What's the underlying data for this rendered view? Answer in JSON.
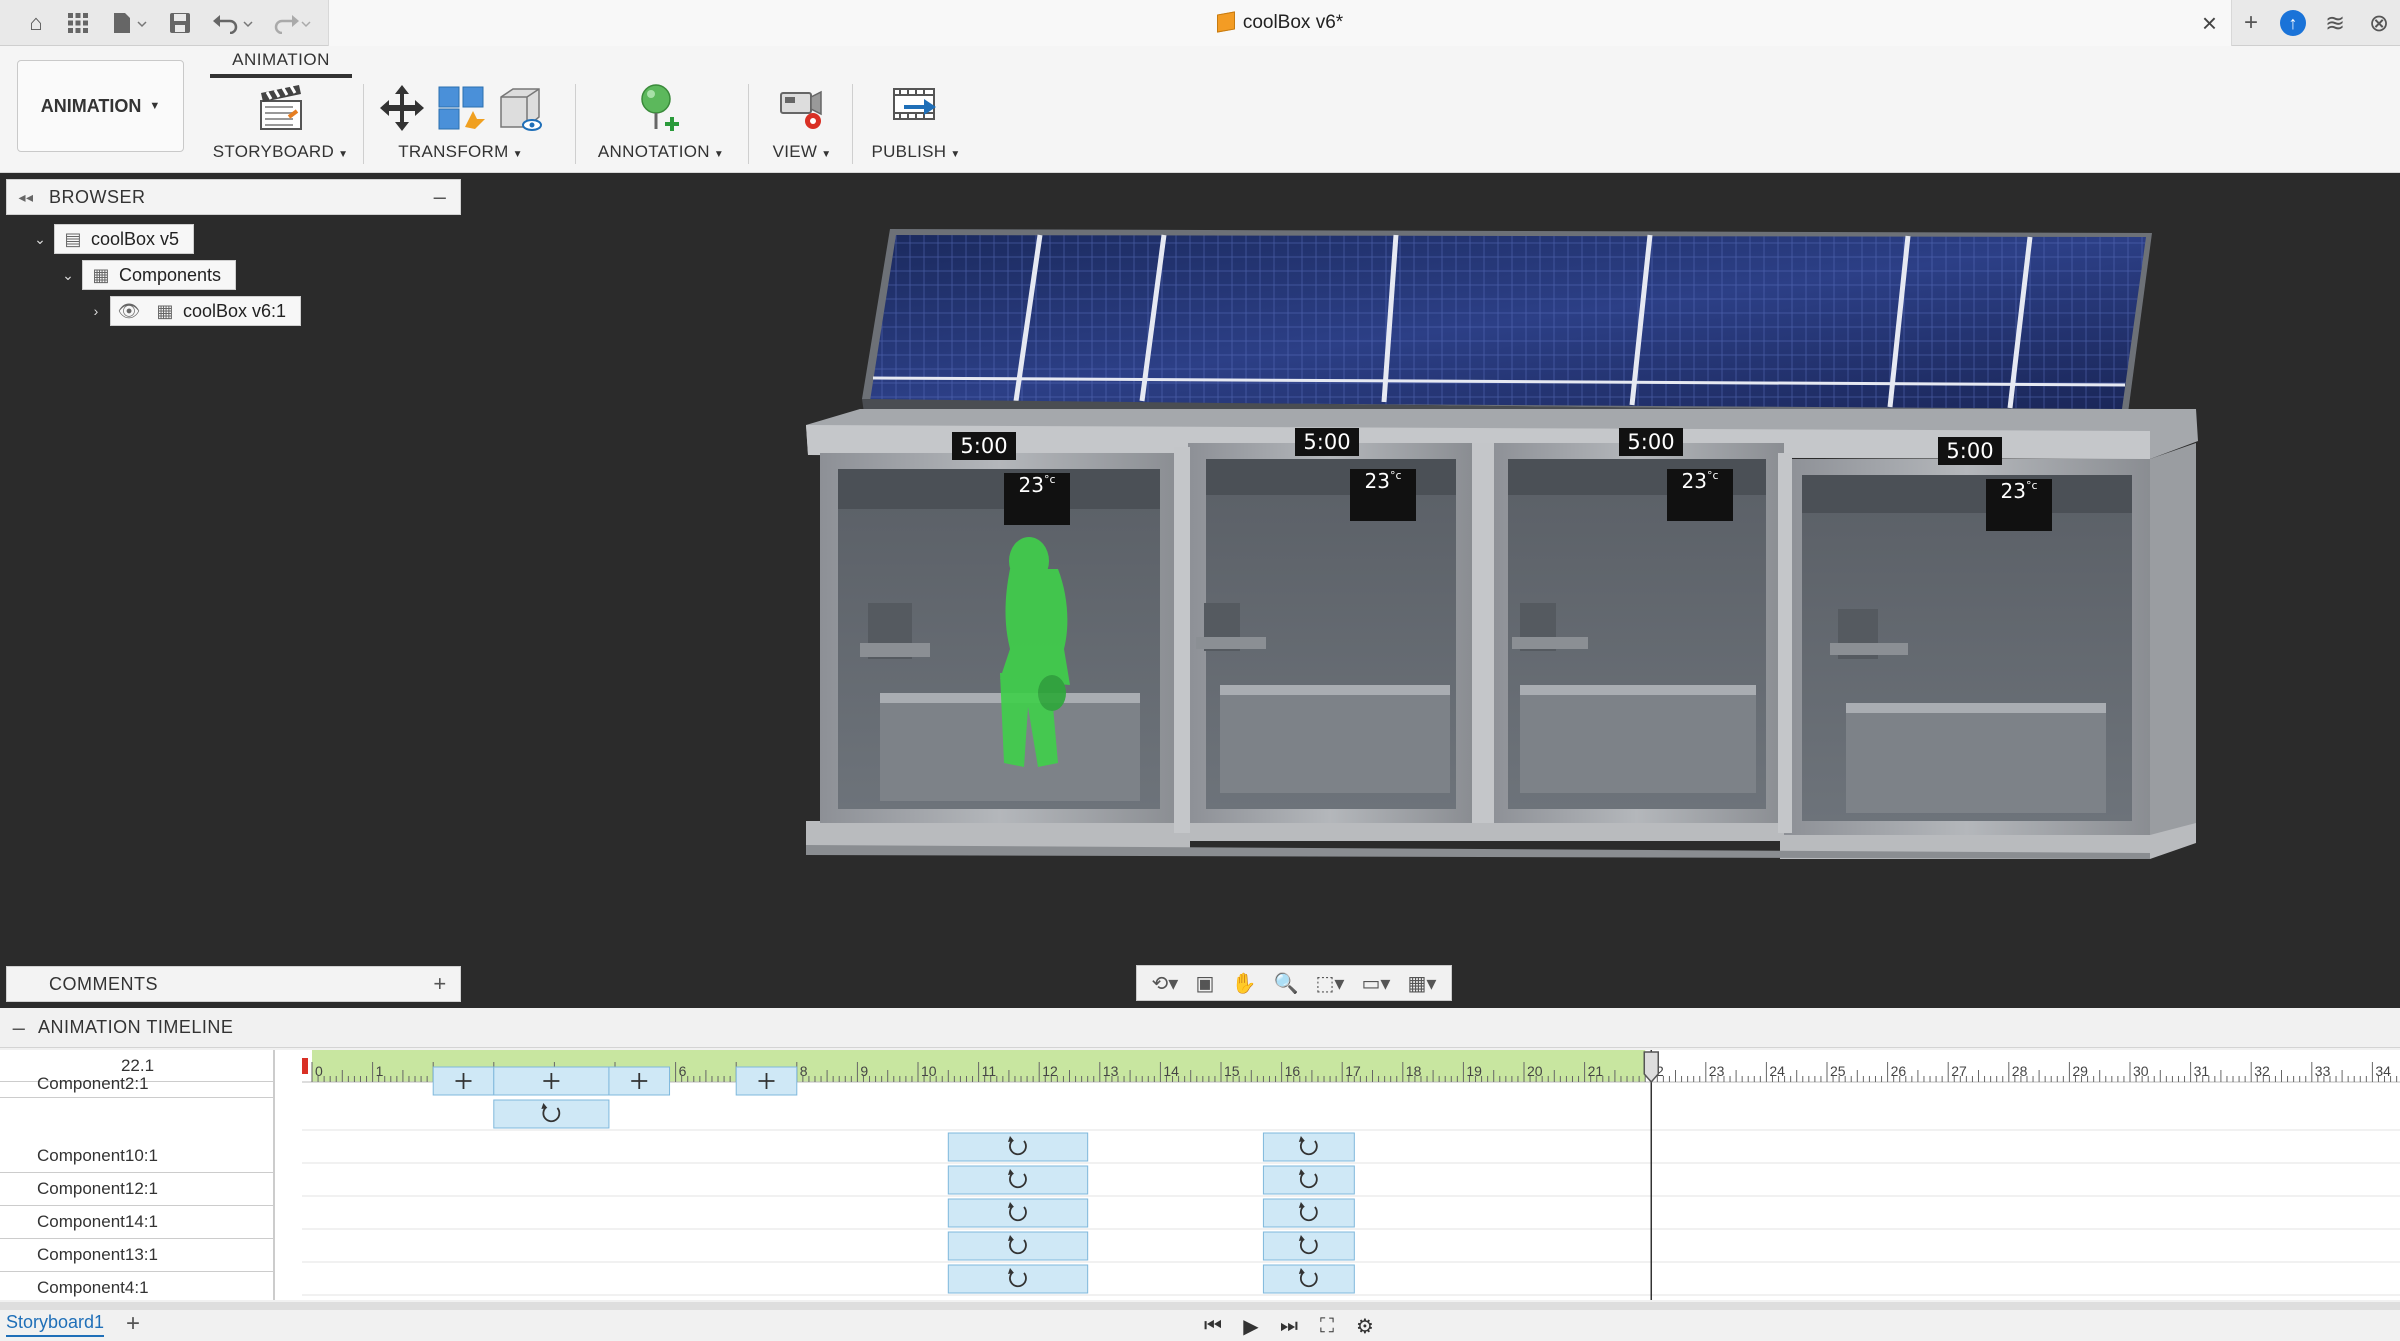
{
  "window": {
    "title": "coolBox v6*",
    "quick_access_icons": [
      "home-icon",
      "grid-icon",
      "file-icon",
      "save-icon",
      "undo-icon",
      "redo-icon"
    ],
    "right_icons": [
      "add-icon",
      "help-icon",
      "job-status-icon",
      "notifications-icon"
    ]
  },
  "toolbar": {
    "workspace_label": "ANIMATION",
    "active_tab": "ANIMATION",
    "groups": [
      {
        "label": "STORYBOARD",
        "icon": "storyboard-icon"
      },
      {
        "label": "TRANSFORM",
        "icon": "transform-icon"
      },
      {
        "label": "ANNOTATION",
        "icon": "annotation-icon"
      },
      {
        "label": "VIEW",
        "icon": "view-icon"
      },
      {
        "label": "PUBLISH",
        "icon": "publish-icon"
      }
    ]
  },
  "browser": {
    "title": "BROWSER",
    "tree": [
      {
        "label": "coolBox v5",
        "expanded": true,
        "icon": "document-icon"
      },
      {
        "label": "Components",
        "expanded": true,
        "icon": "component-group-icon"
      },
      {
        "label": "coolBox v6:1",
        "expanded": false,
        "icon": "component-icon",
        "visible": true
      }
    ]
  },
  "comments": {
    "title": "COMMENTS"
  },
  "scene": {
    "booths": [
      {
        "timer": "5:00",
        "temp": "23",
        "unit": "°c"
      },
      {
        "timer": "5:00",
        "temp": "23",
        "unit": "°c"
      },
      {
        "timer": "5:00",
        "temp": "23",
        "unit": "°c"
      },
      {
        "timer": "5:00",
        "temp": "23",
        "unit": "°c"
      }
    ],
    "person_color": "#3fd04a"
  },
  "navbar": {
    "icons": [
      "orbit-icon",
      "look-at-icon",
      "pan-icon",
      "zoom-icon",
      "fit-icon",
      "display-settings-icon",
      "grid-settings-icon"
    ]
  },
  "timeline": {
    "title": "ANIMATION TIMELINE",
    "current_time": "22.1",
    "ruler_ticks": [
      "0",
      "1",
      "2",
      "3",
      "4",
      "5",
      "6",
      "7",
      "8",
      "9",
      "10",
      "11",
      "12",
      "13",
      "14",
      "15",
      "16",
      "17",
      "18",
      "19",
      "20",
      "21",
      "22",
      "23",
      "24",
      "25",
      "26",
      "27",
      "28",
      "29",
      "30",
      "31",
      "32",
      "33",
      "34"
    ],
    "green_range": [
      0,
      22
    ],
    "rows": [
      {
        "name": "Component2:1",
        "lanes": [
          [
            {
              "type": "move",
              "start": 2.0,
              "end": 3.0
            },
            {
              "type": "move",
              "start": 3.0,
              "end": 4.9
            },
            {
              "type": "move",
              "start": 4.9,
              "end": 5.9
            },
            {
              "type": "move",
              "start": 7.0,
              "end": 8.0
            }
          ],
          [
            {
              "type": "rotate",
              "start": 3.0,
              "end": 4.9
            }
          ]
        ]
      },
      {
        "name": "Component10:1",
        "lanes": [
          [
            {
              "type": "rotate",
              "start": 10.5,
              "end": 12.8
            },
            {
              "type": "rotate",
              "start": 15.7,
              "end": 17.2
            }
          ]
        ]
      },
      {
        "name": "Component12:1",
        "lanes": [
          [
            {
              "type": "rotate",
              "start": 10.5,
              "end": 12.8
            },
            {
              "type": "rotate",
              "start": 15.7,
              "end": 17.2
            }
          ]
        ]
      },
      {
        "name": "Component14:1",
        "lanes": [
          [
            {
              "type": "rotate",
              "start": 10.5,
              "end": 12.8
            },
            {
              "type": "rotate",
              "start": 15.7,
              "end": 17.2
            }
          ]
        ]
      },
      {
        "name": "Component13:1",
        "lanes": [
          [
            {
              "type": "rotate",
              "start": 10.5,
              "end": 12.8
            },
            {
              "type": "rotate",
              "start": 15.7,
              "end": 17.2
            }
          ]
        ]
      },
      {
        "name": "Component4:1",
        "lanes": [
          [
            {
              "type": "rotate",
              "start": 10.5,
              "end": 12.8
            },
            {
              "type": "rotate",
              "start": 15.7,
              "end": 17.2
            }
          ]
        ]
      }
    ],
    "storyboard_tab": "Storyboard1",
    "playback_icons": [
      "skip-to-start-icon",
      "play-icon",
      "skip-to-end-icon",
      "fullscreen-icon",
      "settings-icon"
    ]
  },
  "colors": {
    "viewport_bg": "#2b2b2b",
    "timeline_green": "#c8e6a0",
    "action_fill": "#cfe8f6",
    "action_border": "#7fb8dc",
    "link_blue": "#1f6fb8"
  }
}
